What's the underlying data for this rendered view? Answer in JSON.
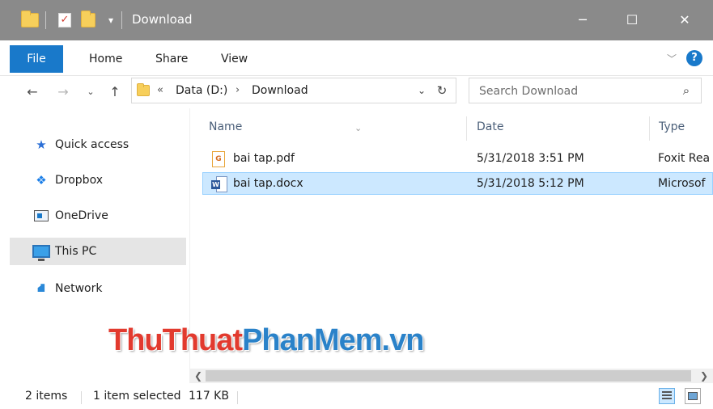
{
  "window": {
    "title": "Download",
    "controls": {
      "minimize": "─",
      "maximize": "☐",
      "close": "✕"
    }
  },
  "ribbon": {
    "tabs": [
      "File",
      "Home",
      "Share",
      "View"
    ],
    "help": "?"
  },
  "address": {
    "overflow": "«",
    "crumbs": [
      "Data (D:)",
      "Download"
    ],
    "separator": "›"
  },
  "search": {
    "placeholder": "Search Download"
  },
  "nav": {
    "items": [
      {
        "label": "Quick access"
      },
      {
        "label": "Dropbox"
      },
      {
        "label": "OneDrive"
      },
      {
        "label": "This PC"
      },
      {
        "label": "Network"
      }
    ]
  },
  "columns": {
    "name": "Name",
    "date": "Date",
    "type": "Type"
  },
  "files": [
    {
      "name": "bai tap.pdf",
      "date": "5/31/2018 3:51 PM",
      "type": "Foxit Rea",
      "icon": "pdf-icon"
    },
    {
      "name": "bai tap.docx",
      "date": "5/31/2018 5:12 PM",
      "type": "Microsof",
      "icon": "word-doc-icon"
    }
  ],
  "status": {
    "count": "2 items",
    "selected": "1 item selected",
    "size": "117 KB"
  },
  "watermark": {
    "part1": "ThuThuat",
    "part2": "PhanMem.vn"
  },
  "colors": {
    "titlebar": "#8a8a8a",
    "file_tab": "#1979ca",
    "selection": "#cce8ff",
    "nav_selected": "#e5e5e5"
  }
}
